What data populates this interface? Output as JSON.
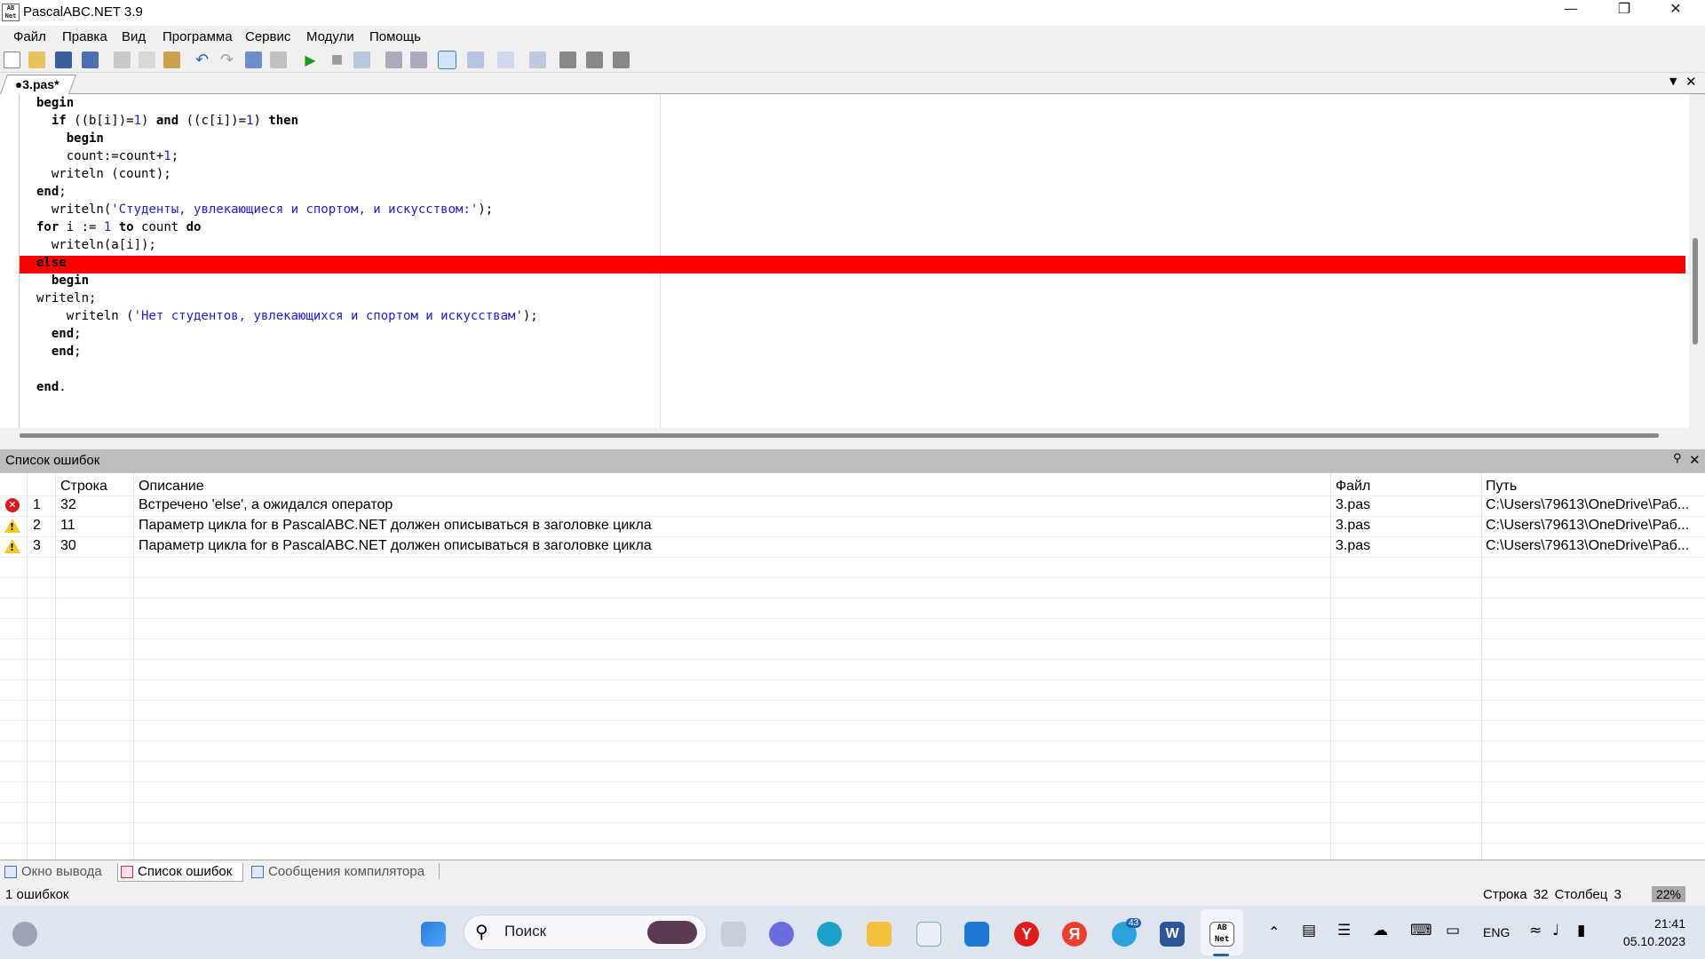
{
  "window": {
    "title": "PascalABC.NET 3.9",
    "icon_text": "AB\nNet"
  },
  "menu": [
    "Файл",
    "Правка",
    "Вид",
    "Программа",
    "Сервис",
    "Модули",
    "Помощь"
  ],
  "doc_tab": {
    "label": "●3.pas*"
  },
  "code_lines": [
    {
      "indent": "",
      "parts": [
        [
          "kw",
          "begin"
        ]
      ]
    },
    {
      "indent": "  ",
      "parts": [
        [
          "kw",
          "if"
        ],
        [
          "t",
          " ((b[i])="
        ],
        [
          "num",
          "1"
        ],
        [
          "t",
          ") "
        ],
        [
          "kw",
          "and"
        ],
        [
          "t",
          " ((c[i])="
        ],
        [
          "num",
          "1"
        ],
        [
          "t",
          ") "
        ],
        [
          "kw",
          "then"
        ]
      ]
    },
    {
      "indent": "    ",
      "parts": [
        [
          "kw",
          "begin"
        ]
      ]
    },
    {
      "indent": "    ",
      "parts": [
        [
          "t",
          "count:=count+"
        ],
        [
          "num",
          "1"
        ],
        [
          "t",
          ";"
        ]
      ]
    },
    {
      "indent": "  ",
      "parts": [
        [
          "t",
          "writeln (count);"
        ]
      ]
    },
    {
      "indent": "",
      "parts": [
        [
          "kw",
          "end"
        ],
        [
          "t",
          ";"
        ]
      ]
    },
    {
      "indent": "  ",
      "parts": [
        [
          "t",
          "writeln("
        ],
        [
          "str",
          "'Студенты, увлекающиеся и спортом, и искусством:'"
        ],
        [
          "t",
          ");"
        ]
      ]
    },
    {
      "indent": "",
      "parts": [
        [
          "kw",
          "for"
        ],
        [
          "t",
          " i := "
        ],
        [
          "num",
          "1"
        ],
        [
          "t",
          " "
        ],
        [
          "kw",
          "to"
        ],
        [
          "t",
          " count "
        ],
        [
          "kw",
          "do"
        ]
      ]
    },
    {
      "indent": "  ",
      "parts": [
        [
          "t",
          "writeln(a[i]);"
        ]
      ]
    },
    {
      "indent": "",
      "parts": [
        [
          "kw",
          "else"
        ]
      ]
    },
    {
      "indent": "  ",
      "parts": [
        [
          "kw",
          "begin"
        ]
      ]
    },
    {
      "indent": "",
      "parts": [
        [
          "t",
          "writeln;"
        ]
      ]
    },
    {
      "indent": "    ",
      "parts": [
        [
          "t",
          "writeln ("
        ],
        [
          "str",
          "'Нет студентов, увлекающихся и спортом и искусствам'"
        ],
        [
          "t",
          ");"
        ]
      ]
    },
    {
      "indent": "  ",
      "parts": [
        [
          "kw",
          "end"
        ],
        [
          "t",
          ";"
        ]
      ]
    },
    {
      "indent": "  ",
      "parts": [
        [
          "kw",
          "end"
        ],
        [
          "t",
          ";"
        ]
      ]
    },
    {
      "indent": "",
      "parts": []
    },
    {
      "indent": "",
      "parts": [
        [
          "kw",
          "end"
        ],
        [
          "t",
          "."
        ]
      ]
    }
  ],
  "error_panel": {
    "title": "Список ошибок",
    "columns": [
      "Строка",
      "Описание",
      "Файл",
      "Путь"
    ],
    "rows": [
      {
        "type": "error",
        "n": "1",
        "line": "32",
        "desc": "Встречено 'else', а ожидался оператор",
        "file": "3.pas",
        "path": "C:\\Users\\79613\\OneDrive\\Раб..."
      },
      {
        "type": "warning",
        "n": "2",
        "line": "11",
        "desc": "Параметр цикла for в PascalABC.NET должен описываться в заголовке цикла",
        "file": "3.pas",
        "path": "C:\\Users\\79613\\OneDrive\\Раб..."
      },
      {
        "type": "warning",
        "n": "3",
        "line": "30",
        "desc": "Параметр цикла for в PascalABC.NET должен описываться в заголовке цикла",
        "file": "3.pas",
        "path": "C:\\Users\\79613\\OneDrive\\Раб..."
      }
    ]
  },
  "bottom_tabs": [
    "Окно вывода",
    "Список ошибок",
    "Сообщения компилятора"
  ],
  "status": {
    "left": "1 ошибкок",
    "position": "Строка  32  Столбец  3",
    "zoom": "22%"
  },
  "taskbar": {
    "search_placeholder": "Поиск",
    "lang": "ENG",
    "time": "21:41",
    "date": "05.10.2023",
    "telegram_badge": "43"
  },
  "colors": {
    "error_line": "#ff0000",
    "keyword": "#000000",
    "string": "#1a1aff",
    "panel_header": "#bdbdbd"
  }
}
